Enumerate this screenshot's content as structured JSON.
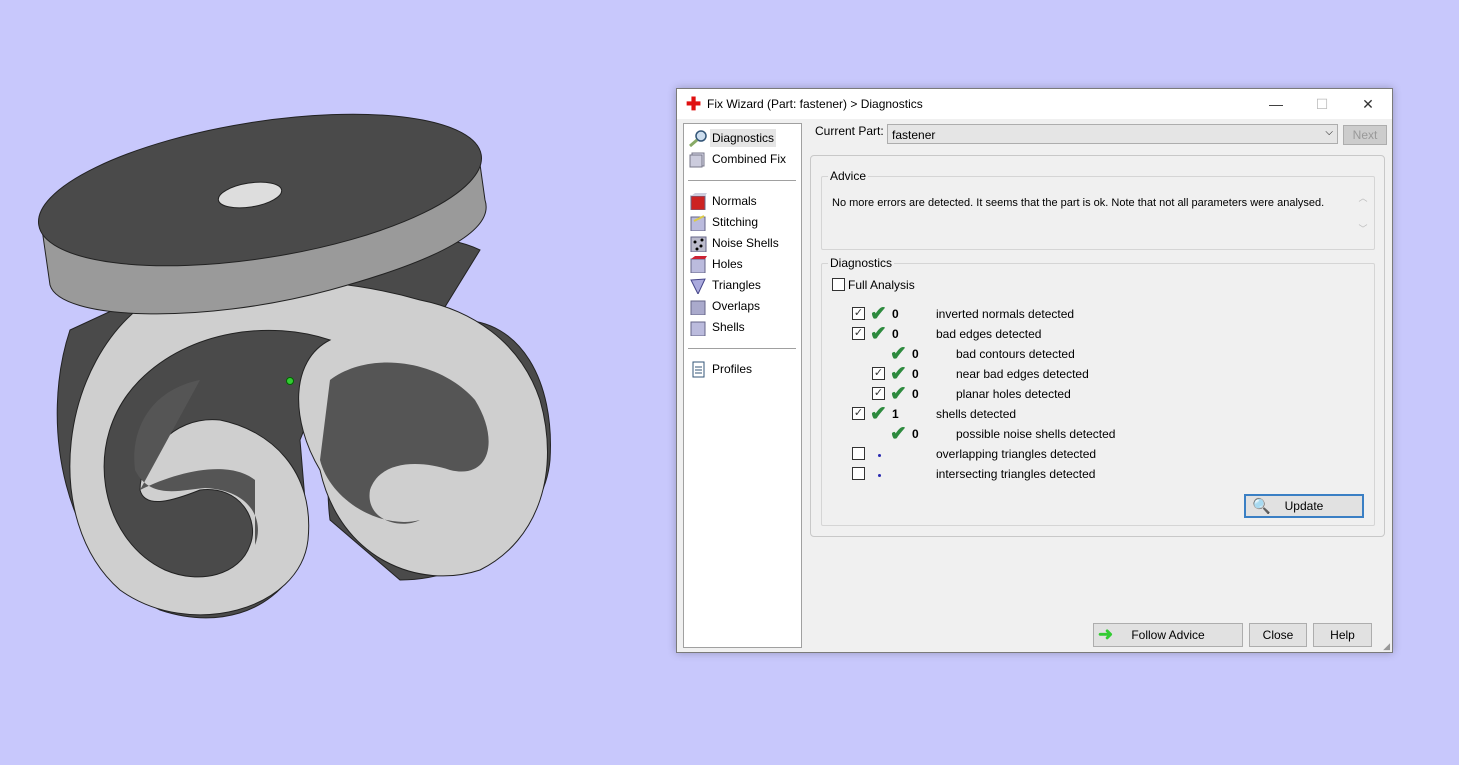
{
  "dialog": {
    "title": "Fix Wizard (Part: fastener) > Diagnostics",
    "window_controls": {
      "minimize": "—",
      "maximize": "☐",
      "close": "✕"
    },
    "nav": [
      {
        "label": "Diagnostics",
        "icon": "magnifier-icon",
        "selected": true
      },
      {
        "label": "Combined Fix",
        "icon": "combined-fix-icon"
      },
      {
        "label": "Normals",
        "icon": "normals-cube-icon"
      },
      {
        "label": "Stitching",
        "icon": "stitching-cube-icon"
      },
      {
        "label": "Noise Shells",
        "icon": "noise-shells-icon"
      },
      {
        "label": "Holes",
        "icon": "holes-cube-icon"
      },
      {
        "label": "Triangles",
        "icon": "triangles-icon"
      },
      {
        "label": "Overlaps",
        "icon": "overlaps-icon"
      },
      {
        "label": "Shells",
        "icon": "shells-cube-icon"
      },
      {
        "label": "Profiles",
        "icon": "document-icon"
      }
    ],
    "current_part_label": "Current Part:",
    "current_part_value": "fastener",
    "next_label": "Next",
    "advice": {
      "title": "Advice",
      "text": "No more errors are detected. It seems that the part is ok. Note that not all parameters were analysed."
    },
    "diagnostics": {
      "title": "Diagnostics",
      "full_analysis_label": "Full Analysis",
      "full_analysis_checked": false,
      "rows": [
        {
          "checkbox": true,
          "checked": true,
          "status": "ok",
          "count": "0",
          "label": "inverted normals detected",
          "level": 0
        },
        {
          "checkbox": true,
          "checked": true,
          "status": "ok",
          "count": "0",
          "label": "bad edges detected",
          "level": 0
        },
        {
          "checkbox": false,
          "checked": false,
          "status": "ok",
          "count": "0",
          "label": "bad contours detected",
          "level": 1
        },
        {
          "checkbox": true,
          "checked": true,
          "status": "ok",
          "count": "0",
          "label": "near bad edges detected",
          "level": 1
        },
        {
          "checkbox": true,
          "checked": true,
          "status": "ok",
          "count": "0",
          "label": "planar holes detected",
          "level": 1
        },
        {
          "checkbox": true,
          "checked": true,
          "status": "ok",
          "count": "1",
          "label": "shells detected",
          "level": 0
        },
        {
          "checkbox": false,
          "checked": false,
          "status": "ok",
          "count": "0",
          "label": "possible noise shells detected",
          "level": 1
        },
        {
          "checkbox": true,
          "checked": false,
          "status": "pending",
          "count": "",
          "label": "overlapping triangles detected",
          "level": 0
        },
        {
          "checkbox": true,
          "checked": false,
          "status": "pending",
          "count": "",
          "label": "intersecting triangles detected",
          "level": 0
        }
      ],
      "update_label": "Update"
    },
    "buttons": {
      "follow_advice": "Follow Advice",
      "close": "Close",
      "help": "Help"
    },
    "colors": {
      "ok_check": "#2d8a3e",
      "viewport_bg": "#c8c8fc"
    }
  }
}
